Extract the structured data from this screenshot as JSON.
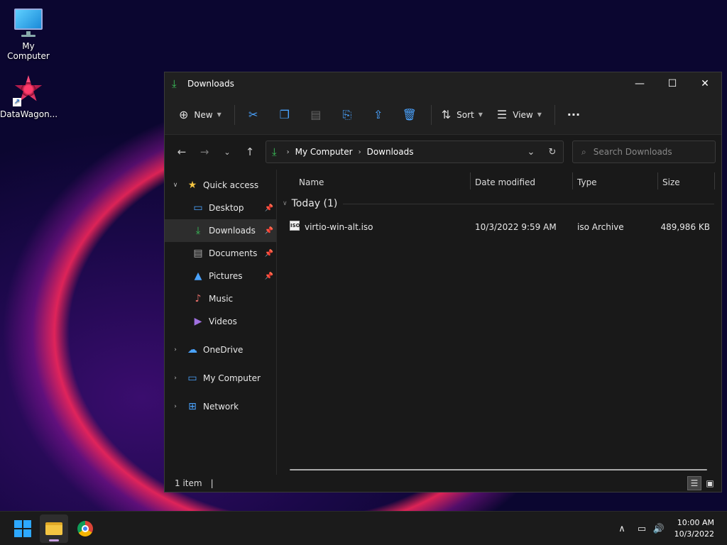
{
  "desktop": {
    "icons": [
      {
        "label": "My Computer"
      },
      {
        "label": "DataWagon..."
      }
    ]
  },
  "window": {
    "title": "Downloads",
    "controls": {
      "minimize": "—",
      "maximize": "☐",
      "close": "✕"
    }
  },
  "toolbar": {
    "new_label": "New",
    "sort_label": "Sort",
    "view_label": "View",
    "more_label": "···"
  },
  "address": {
    "crumbs": [
      "My Computer",
      "Downloads"
    ]
  },
  "search": {
    "placeholder": "Search Downloads"
  },
  "navpane": {
    "quick_access": "Quick access",
    "items": [
      {
        "label": "Desktop",
        "pinned": true
      },
      {
        "label": "Downloads",
        "pinned": true,
        "selected": true
      },
      {
        "label": "Documents",
        "pinned": true
      },
      {
        "label": "Pictures",
        "pinned": true
      },
      {
        "label": "Music",
        "pinned": false
      },
      {
        "label": "Videos",
        "pinned": false
      }
    ],
    "roots": [
      {
        "label": "OneDrive"
      },
      {
        "label": "My Computer"
      },
      {
        "label": "Network"
      }
    ]
  },
  "filelist": {
    "columns": [
      "Name",
      "Date modified",
      "Type",
      "Size"
    ],
    "group": "Today (1)",
    "rows": [
      {
        "name": "virtio-win-alt.iso",
        "date": "10/3/2022 9:59 AM",
        "type": "iso Archive",
        "size": "489,986 KB",
        "icon_text": "ISO"
      }
    ]
  },
  "status": {
    "count": "1 item",
    "cursor_bar": "|"
  },
  "taskbar": {
    "time": "10:00 AM",
    "date": "10/3/2022"
  },
  "colors": {
    "accent": "#3bc25a",
    "blue": "#4aa3ff"
  }
}
